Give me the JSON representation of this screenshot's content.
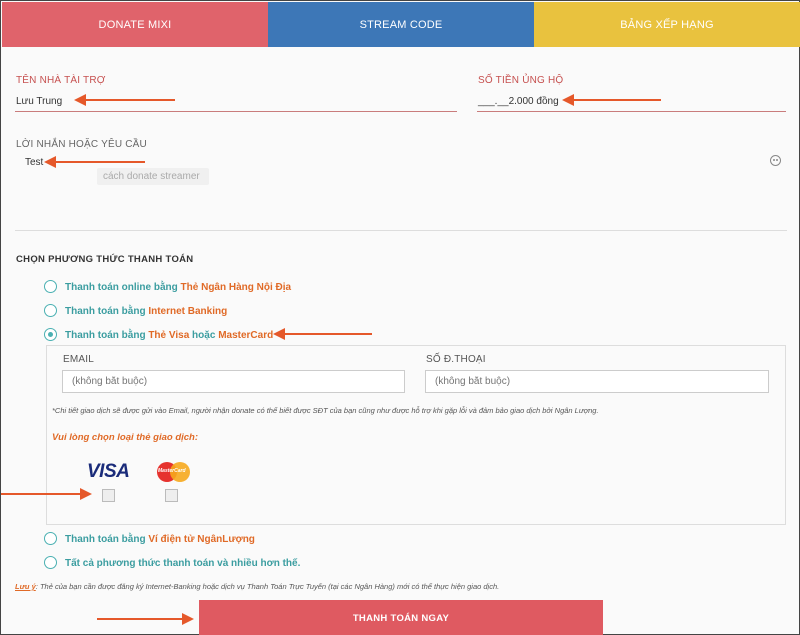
{
  "tabs": [
    {
      "label": "DONATE MIXI"
    },
    {
      "label": "STREAM CODE"
    },
    {
      "label": "BẢNG XẾP HẠNG"
    }
  ],
  "form": {
    "sponsor_label": "TÊN NHÀ TÀI TRỢ",
    "sponsor_value": "Lưu Trung",
    "amount_label": "SỐ TIỀN ỦNG HỘ",
    "amount_value": "___.__2.000 đồng",
    "message_label": "LỜI NHẮN HOẶC YÊU CẦU",
    "message_value": "Test",
    "message_hint": "cách donate streamer"
  },
  "payment": {
    "title": "CHỌN PHƯƠNG THỨC THANH TOÁN",
    "options": [
      {
        "prefix": "Thanh toán online bằng ",
        "highlight": "Thẻ Ngân Hàng Nội Địa",
        "suffix": "",
        "checked": false
      },
      {
        "prefix": "Thanh toán bằng ",
        "highlight": "Internet Banking",
        "suffix": "",
        "checked": false
      },
      {
        "prefix": "Thanh toán bằng ",
        "highlight": "Thẻ Visa",
        "middle": " hoặc ",
        "highlight2": "MasterCard",
        "checked": true
      },
      {
        "prefix": "Thanh toán bằng ",
        "highlight": "Ví điện tử NgânLượng",
        "suffix": "",
        "checked": false
      },
      {
        "prefix": "Tất cả phương thức thanh toán và nhiều hơn thế.",
        "highlight": "",
        "suffix": "",
        "checked": false
      }
    ],
    "card_panel": {
      "email_label": "EMAIL",
      "email_placeholder": "(không bắt buộc)",
      "phone_label": "SỐ Đ.THOẠI",
      "phone_placeholder": "(không bắt buộc)",
      "note": "*Chi tiết giao dịch sẽ được gửi vào Email, người nhận donate có thể biết được SĐT của bạn cũng như được hỗ trợ khi gặp lỗi và đảm bảo giao dịch bởi Ngân Lượng.",
      "choose_card": "Vui lòng chọn loại thẻ giao dịch:",
      "visa_text": "VISA",
      "mastercard_text": "MasterCard"
    },
    "footnote_label": "Lưu ý",
    "footnote": ": Thẻ của bạn cần được đăng ký Internet-Banking hoặc dịch vụ Thanh Toán Trực Tuyến (tại các Ngân Hàng) mới có thể thực hiện giao dịch.",
    "submit_label": "THANH TOÁN NGAY"
  },
  "colors": {
    "tab_donate": "#e0636b",
    "tab_stream": "#3d77b7",
    "tab_ranking": "#e9c23e",
    "accent_teal": "#3b9da0",
    "accent_orange": "#e06a27",
    "annotation_arrow": "#e5582a",
    "submit_button": "#df5a61"
  }
}
